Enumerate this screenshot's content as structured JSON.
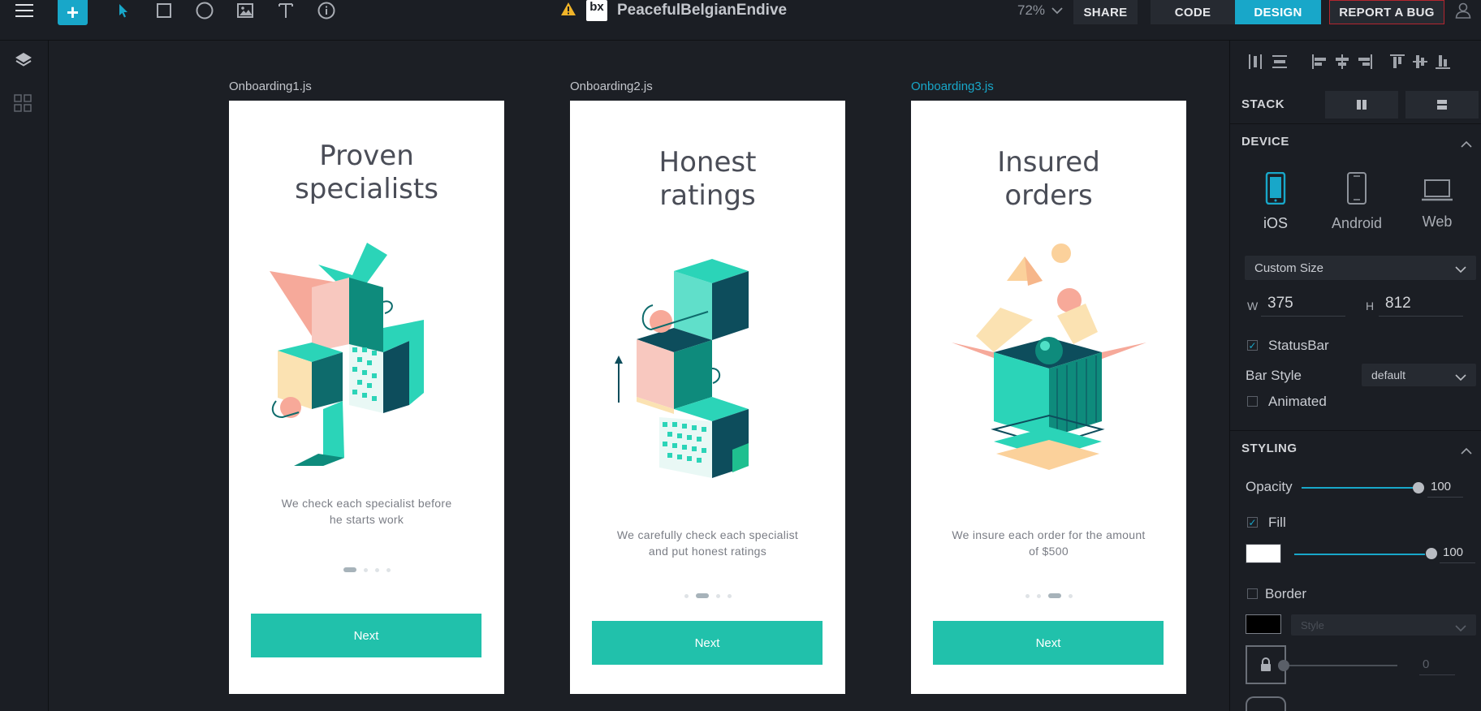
{
  "app": {
    "project_title": "PeacefulBelgianEndive",
    "logo_text": "bx",
    "zoom": "72%",
    "buttons": {
      "share": "SHARE",
      "code": "CODE",
      "design": "DESIGN",
      "report_bug": "REPORT A BUG"
    },
    "accent_color": "#18a7c9"
  },
  "toolbar": {
    "add": "+",
    "tools": [
      "menu-icon",
      "pointer-icon",
      "rectangle-icon",
      "ellipse-icon",
      "image-icon",
      "text-icon",
      "info-icon"
    ]
  },
  "canvas": {
    "frames": [
      {
        "file": "Onboarding1.js",
        "title_line1": "Proven",
        "title_line2": "specialists",
        "subtitle_line1": "We check each specialist before",
        "subtitle_line2": "he starts work",
        "active_dot": 0,
        "button": "Next"
      },
      {
        "file": "Onboarding2.js",
        "title_line1": "Honest",
        "title_line2": "ratings",
        "subtitle_line1": "We carefully check each specialist",
        "subtitle_line2": "and put honest ratings",
        "active_dot": 1,
        "button": "Next"
      },
      {
        "file": "Onboarding3.js",
        "title_line1": "Insured",
        "title_line2": "orders",
        "subtitle_line1": "We insure each order for the amount",
        "subtitle_line2": "of $500",
        "active_dot": 2,
        "button": "Next"
      }
    ],
    "active_frame": 2,
    "button_color": "#21c1ab"
  },
  "panel": {
    "stack_label": "STACK",
    "device": {
      "header": "DEVICE",
      "options": [
        "iOS",
        "Android",
        "Web"
      ],
      "selected": "iOS",
      "size_select": "Custom Size",
      "w_label": "W",
      "w_value": "375",
      "h_label": "H",
      "h_value": "812",
      "statusbar_label": "StatusBar",
      "statusbar_checked": true,
      "bar_style_label": "Bar Style",
      "bar_style_value": "default",
      "animated_label": "Animated",
      "animated_checked": false
    },
    "styling": {
      "header": "STYLING",
      "opacity_label": "Opacity",
      "opacity_value": "100",
      "fill_label": "Fill",
      "fill_checked": true,
      "fill_color": "#ffffff",
      "fill_opacity": "100",
      "border_label": "Border",
      "border_checked": false,
      "border_color": "#000000",
      "border_style_placeholder": "Style",
      "border_width": "0"
    }
  }
}
